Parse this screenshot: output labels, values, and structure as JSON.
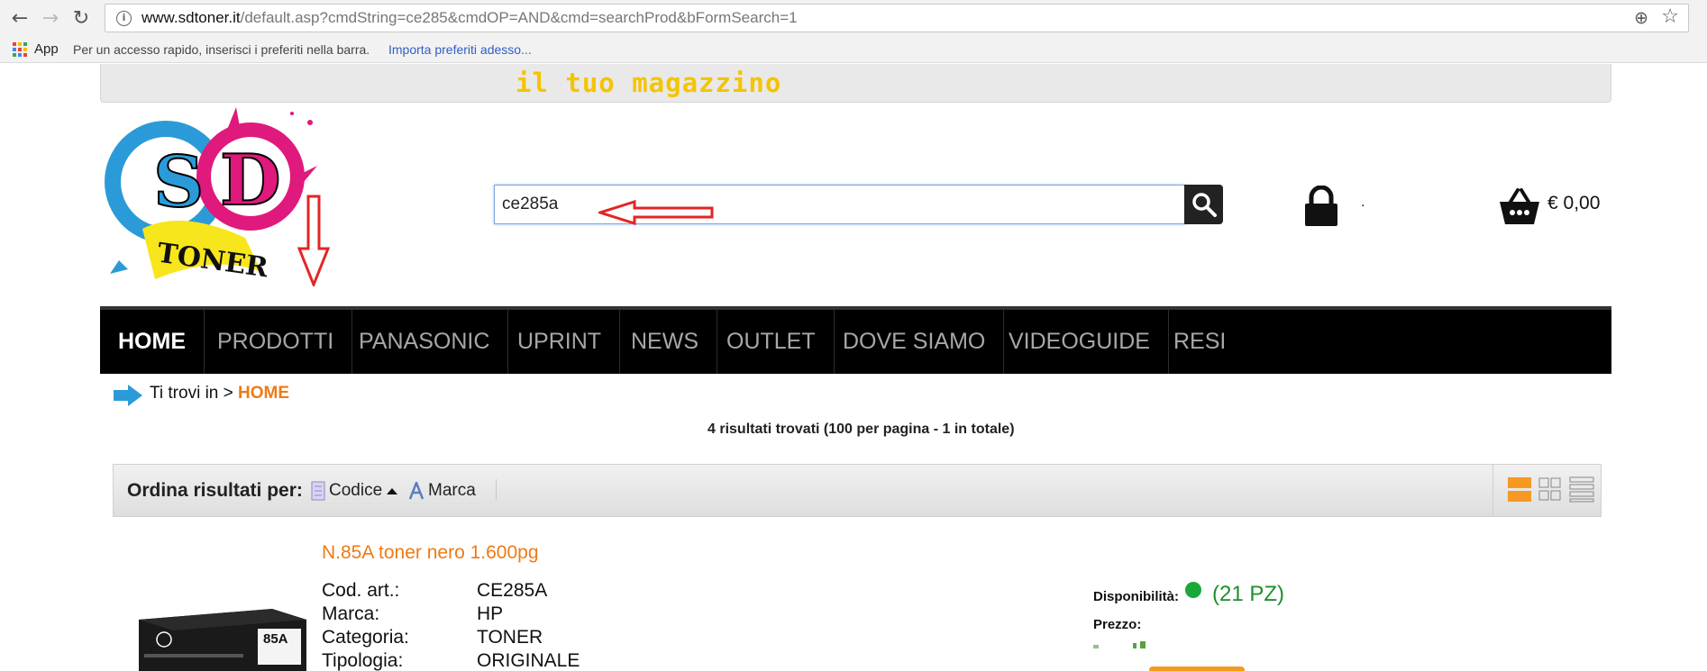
{
  "browser": {
    "url_host": "www.sdtoner.it",
    "url_path": "/default.asp?cmdString=ce285&cmdOP=AND&cmd=searchProd&bFormSearch=1",
    "bookmarks": {
      "apps_label": "App",
      "hint": "Per un accesso rapido, inserisci i preferiti nella barra.",
      "import_link": "Importa preferiti adesso..."
    }
  },
  "header": {
    "tagline": "il tuo magazzino",
    "logo_text": "SD TONER",
    "search_value": "ce285a",
    "user_placeholder": ".",
    "cart_total": "€ 0,00"
  },
  "nav": {
    "items": [
      "HOME",
      "PRODOTTI",
      "PANASONIC",
      "UPRINT",
      "NEWS",
      "OUTLET",
      "DOVE SIAMO",
      "VIDEOGUIDE",
      "RESI"
    ],
    "active": "HOME"
  },
  "breadcrumb": {
    "prefix": "Ti trovi in",
    "separator": ">",
    "current": "HOME"
  },
  "results": {
    "summary": "4 risultati trovati (100 per pagina - 1 in totale)"
  },
  "sort": {
    "title": "Ordina risultati per:",
    "options": [
      "Codice",
      "Marca"
    ]
  },
  "product": {
    "title": "N.85A toner nero 1.600pg",
    "box_label": "85A",
    "specs": [
      {
        "label": "Cod. art.:",
        "value": "CE285A"
      },
      {
        "label": "Marca:",
        "value": "HP"
      },
      {
        "label": "Categoria:",
        "value": "TONER"
      },
      {
        "label": "Tipologia:",
        "value": "ORIGINALE"
      }
    ],
    "availability_label": "Disponibilità:",
    "availability_qty": "(21 PZ)",
    "price_label": "Prezzo:"
  },
  "colors": {
    "accent_orange": "#f07a13",
    "tagline_yellow": "#f5c400",
    "stock_green": "#1aa83b",
    "nav_bg": "#000000"
  }
}
